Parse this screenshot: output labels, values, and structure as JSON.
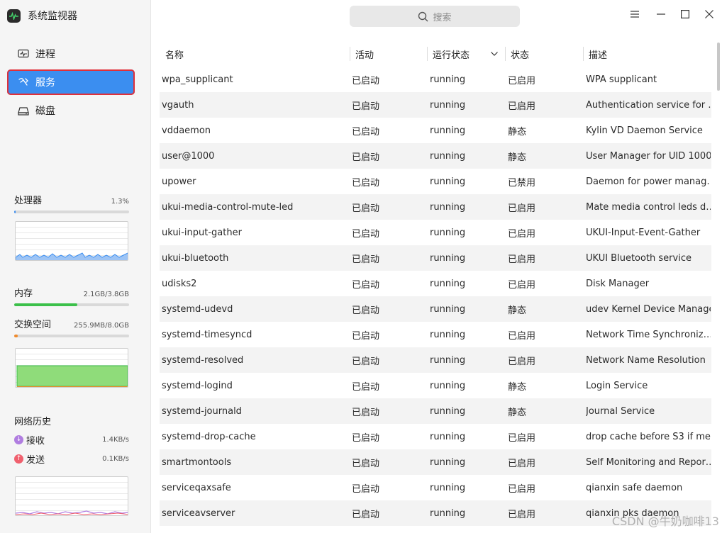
{
  "app": {
    "title": "系统监视器"
  },
  "nav": [
    {
      "label": "进程",
      "icon": "process-icon"
    },
    {
      "label": "服务",
      "icon": "service-icon",
      "active": true
    },
    {
      "label": "磁盘",
      "icon": "disk-icon"
    }
  ],
  "cpu": {
    "label": "处理器",
    "value": "1.3%",
    "usage": 0.013,
    "color": "#3b8ef0"
  },
  "memory": {
    "label": "内存",
    "value": "2.1GB/3.8GB",
    "usage": 0.55,
    "color": "#3cc04a"
  },
  "swap": {
    "label": "交换空间",
    "value": "255.9MB/8.0GB",
    "usage": 0.03,
    "color": "#f08a2b"
  },
  "network": {
    "label": "网络历史",
    "receive": {
      "label": "接收",
      "value": "1.4KB/s",
      "color": "#b07de0"
    },
    "send": {
      "label": "发送",
      "value": "0.1KB/s",
      "color": "#f0606e"
    }
  },
  "search": {
    "placeholder": "搜索"
  },
  "window": {
    "menu_icon": "menu-icon",
    "min_icon": "minimize-icon",
    "max_icon": "maximize-icon",
    "close_icon": "close-icon"
  },
  "table": {
    "columns": [
      "名称",
      "活动",
      "运行状态",
      "状态",
      "描述"
    ],
    "rows": [
      [
        "wpa_supplicant",
        "已启动",
        "running",
        "已启用",
        "WPA supplicant"
      ],
      [
        "vgauth",
        "已启动",
        "running",
        "已启用",
        "Authentication service for …"
      ],
      [
        "vddaemon",
        "已启动",
        "running",
        "静态",
        "Kylin VD Daemon Service"
      ],
      [
        "user@1000",
        "已启动",
        "running",
        "静态",
        "User Manager for UID 1000"
      ],
      [
        "upower",
        "已启动",
        "running",
        "已禁用",
        "Daemon for power manag…"
      ],
      [
        "ukui-media-control-mute-led",
        "已启动",
        "running",
        "已启用",
        "Mate media control leds d…"
      ],
      [
        "ukui-input-gather",
        "已启动",
        "running",
        "已启用",
        "UKUI-Input-Event-Gather"
      ],
      [
        "ukui-bluetooth",
        "已启动",
        "running",
        "已启用",
        "UKUI Bluetooth service"
      ],
      [
        "udisks2",
        "已启动",
        "running",
        "已启用",
        "Disk Manager"
      ],
      [
        "systemd-udevd",
        "已启动",
        "running",
        "静态",
        "udev Kernel Device Manager"
      ],
      [
        "systemd-timesyncd",
        "已启动",
        "running",
        "已启用",
        "Network Time Synchroniz…"
      ],
      [
        "systemd-resolved",
        "已启动",
        "running",
        "已启用",
        "Network Name Resolution"
      ],
      [
        "systemd-logind",
        "已启动",
        "running",
        "静态",
        "Login Service"
      ],
      [
        "systemd-journald",
        "已启动",
        "running",
        "静态",
        "Journal Service"
      ],
      [
        "systemd-drop-cache",
        "已启动",
        "running",
        "已启用",
        "drop cache before S3 if me…"
      ],
      [
        "smartmontools",
        "已启动",
        "running",
        "已启用",
        "Self Monitoring and Repor…"
      ],
      [
        "serviceqaxsafe",
        "已启动",
        "running",
        "已启用",
        "qianxin safe daemon"
      ],
      [
        "serviceavserver",
        "已启动",
        "running",
        "已启用",
        "qianxin pks daemon"
      ]
    ]
  },
  "watermark": "CSDN @牛奶咖啡13"
}
